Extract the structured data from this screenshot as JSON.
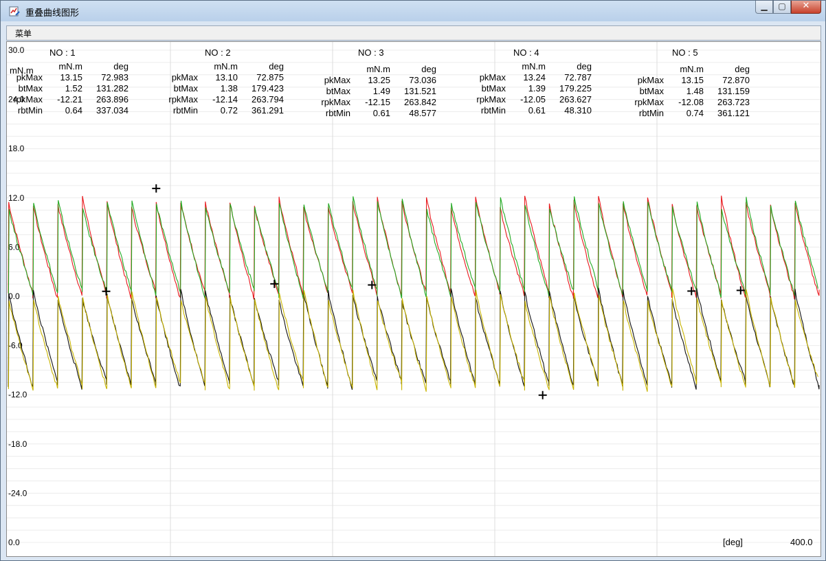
{
  "window": {
    "title": "重叠曲线图形",
    "minimize_icon": "minimize-icon",
    "maximize_icon": "maximize-icon",
    "close_icon": "close-icon"
  },
  "menu": {
    "label": "菜单"
  },
  "left_unit": "mN.m",
  "colors": {
    "red": "#e8181c",
    "green": "#22aa22",
    "black": "#111111",
    "yellow": "#c8b400"
  },
  "panels": [
    {
      "no": "NO : 1",
      "h1": "mN.m",
      "h2": "deg",
      "rows": [
        [
          "pkMax",
          "13.15",
          "72.983"
        ],
        [
          "btMax",
          "1.52",
          "131.282"
        ],
        [
          "rpkMax",
          "-12.21",
          "263.896"
        ],
        [
          "rbtMin",
          "0.64",
          "337.034"
        ]
      ]
    },
    {
      "no": "NO : 2",
      "h1": "mN.m",
      "h2": "deg",
      "rows": [
        [
          "pkMax",
          "13.10",
          "72.875"
        ],
        [
          "btMax",
          "1.38",
          "179.423"
        ],
        [
          "rpkMax",
          "-12.14",
          "263.794"
        ],
        [
          "rbtMin",
          "0.72",
          "361.291"
        ]
      ]
    },
    {
      "no": "NO : 3",
      "h1": "mN.m",
      "h2": "deg",
      "rows": [
        [
          "pkMax",
          "13.25",
          "73.036"
        ],
        [
          "btMax",
          "1.49",
          "131.521"
        ],
        [
          "rpkMax",
          "-12.15",
          "263.842"
        ],
        [
          "rbtMin",
          "0.61",
          "48.577"
        ]
      ]
    },
    {
      "no": "NO : 4",
      "h1": "mN.m",
      "h2": "deg",
      "rows": [
        [
          "pkMax",
          "13.24",
          "72.787"
        ],
        [
          "btMax",
          "1.39",
          "179.225"
        ],
        [
          "rpkMax",
          "-12.05",
          "263.627"
        ],
        [
          "rbtMin",
          "0.61",
          "48.310"
        ]
      ]
    },
    {
      "no": "NO : 5",
      "h1": "mN.m",
      "h2": "deg",
      "rows": [
        [
          "pkMax",
          "13.15",
          "72.870"
        ],
        [
          "btMax",
          "1.48",
          "131.159"
        ],
        [
          "rpkMax",
          "-12.08",
          "263.723"
        ],
        [
          "rbtMin",
          "0.74",
          "361.121"
        ]
      ]
    }
  ],
  "chart_data": {
    "type": "line",
    "xlabel": "[deg]",
    "x_unit": "[deg]",
    "x_max_label": "400.0",
    "x_min_label": "0.0",
    "xlim": [
      0,
      400
    ],
    "ylim": [
      -30,
      30
    ],
    "ytick_labels": [
      "30.0",
      "24.0",
      "18.0",
      "12.0",
      "6.0",
      "0.0",
      "-6.0",
      "-12.0",
      "-18.0",
      "-24.0"
    ],
    "grid": true,
    "cycles": 33,
    "series": [
      {
        "color": "#e8181c",
        "peak": 11.5,
        "trough": 0.3
      },
      {
        "color": "#22aa22",
        "peak": 11.4,
        "trough": 0.4
      },
      {
        "color": "#111111",
        "peak": 0.3,
        "trough": -10.8
      },
      {
        "color": "#c8b400",
        "peak": 0.2,
        "trough": -10.9
      }
    ],
    "markers": [
      {
        "x": 72.983,
        "y": 13.15
      },
      {
        "x": 48.31,
        "y": 0.61
      },
      {
        "x": 131.282,
        "y": 1.52
      },
      {
        "x": 179.423,
        "y": 1.38
      },
      {
        "x": 263.627,
        "y": -12.05
      },
      {
        "x": 337.034,
        "y": 0.64
      },
      {
        "x": 361.291,
        "y": 0.72
      }
    ]
  }
}
